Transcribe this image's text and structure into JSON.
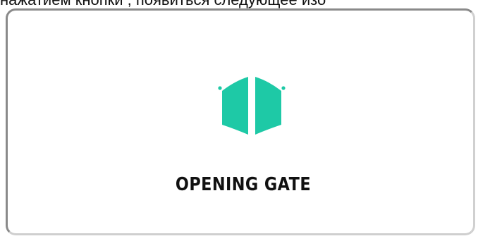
{
  "caption_fragment": "нажатием кнопки       , появиться следующее изо",
  "dialog": {
    "status_text": "OPENING GATE",
    "icon": "gate-opening-icon",
    "accent_color": "#1ec9a6"
  }
}
